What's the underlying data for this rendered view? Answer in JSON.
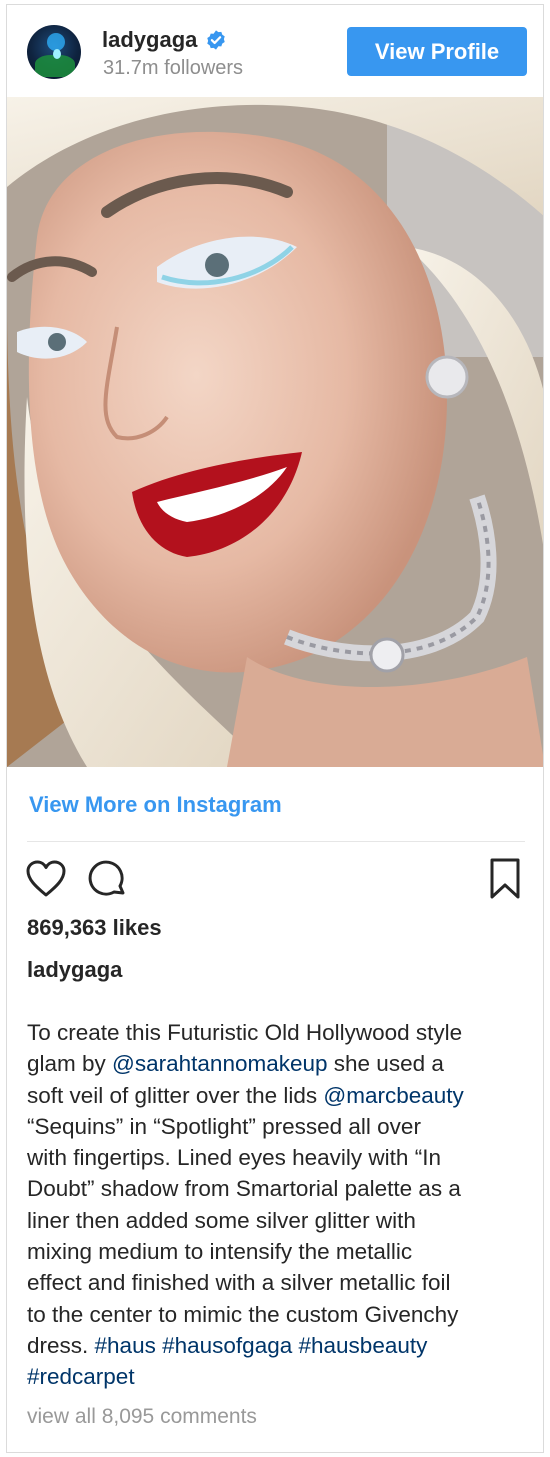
{
  "header": {
    "username": "ladygaga",
    "followers": "31.7m followers",
    "view_profile_label": "View Profile",
    "verified_icon": "verified-badge-icon"
  },
  "photo": {
    "description_icon": "post-photo"
  },
  "links": {
    "view_more": "View More on Instagram",
    "view_comments": "view all 8,095 comments"
  },
  "actions": {
    "like_icon": "heart-icon",
    "comment_icon": "comment-icon",
    "save_icon": "bookmark-icon"
  },
  "post": {
    "likes": "869,363 likes",
    "caption_user": "ladygaga",
    "caption_lines": [
      [
        {
          "t": "To create this Futuristic Old Hollywood style"
        }
      ],
      [
        {
          "t": "glam by "
        },
        {
          "t": "@sarahtannomakeup",
          "tag": true
        },
        {
          "t": " she used a"
        }
      ],
      [
        {
          "t": "soft veil of glitter over the lids "
        },
        {
          "t": "@marcbeauty",
          "tag": true
        }
      ],
      [
        {
          "t": "“Sequins” in “Spotlight” pressed all over"
        }
      ],
      [
        {
          "t": "with fingertips. Lined eyes heavily with “In"
        }
      ],
      [
        {
          "t": "Doubt” shadow from Smartorial palette as a"
        }
      ],
      [
        {
          "t": "liner then added some silver glitter with"
        }
      ],
      [
        {
          "t": "mixing medium to intensify the metallic"
        }
      ],
      [
        {
          "t": "effect and finished with a silver metallic foil"
        }
      ],
      [
        {
          "t": "to the center to mimic the custom Givenchy"
        }
      ],
      [
        {
          "t": "dress. "
        },
        {
          "t": "#haus",
          "tag": true
        },
        {
          "t": " "
        },
        {
          "t": "#hausofgaga",
          "tag": true
        },
        {
          "t": " "
        },
        {
          "t": "#hausbeauty",
          "tag": true
        }
      ],
      [
        {
          "t": "#redcarpet",
          "tag": true
        }
      ]
    ]
  },
  "colors": {
    "accent": "#3897f0",
    "tag": "#003569",
    "muted": "#8e8e8e"
  }
}
